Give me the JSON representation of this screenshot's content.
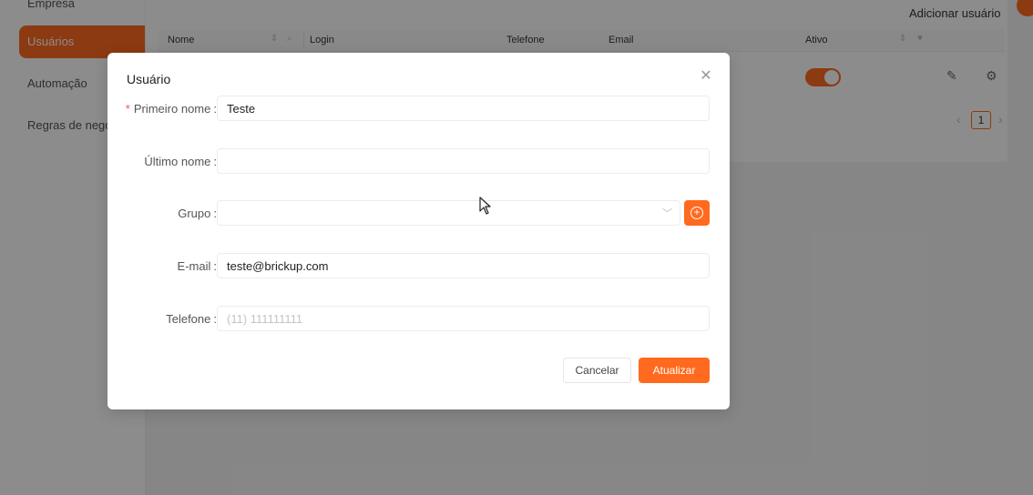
{
  "sidebar": {
    "items": [
      {
        "label": "Empresa"
      },
      {
        "label": "Usuários"
      },
      {
        "label": "Automação"
      },
      {
        "label": "Regras de negócio"
      }
    ]
  },
  "page": {
    "add_user_label": "Adicionar usuário",
    "table": {
      "headers": {
        "nome": "Nome",
        "login": "Login",
        "telefone": "Telefone",
        "email": "Email",
        "ativo": "Ativo"
      }
    },
    "pagination": {
      "current_page": "1"
    }
  },
  "modal": {
    "title": "Usuário",
    "fields": {
      "first_name": {
        "label": "Primeiro nome",
        "value": "Teste",
        "required": true
      },
      "last_name": {
        "label": "Último nome",
        "value": ""
      },
      "group": {
        "label": "Grupo",
        "value": ""
      },
      "email": {
        "label": "E-mail",
        "value": "teste@brickup.com"
      },
      "phone": {
        "label": "Telefone",
        "value": "",
        "placeholder": "(11) 111111111"
      }
    },
    "cancel_label": "Cancelar",
    "update_label": "Atualizar"
  },
  "colors": {
    "accent": "#ff6a1f",
    "required": "#ff4d4f"
  },
  "icons": [
    "close-icon",
    "chevron-down-icon",
    "plus-circle-icon",
    "edit-icon",
    "settings-icon",
    "sort-icon",
    "search-icon",
    "filter-icon",
    "mouse-cursor-icon"
  ]
}
